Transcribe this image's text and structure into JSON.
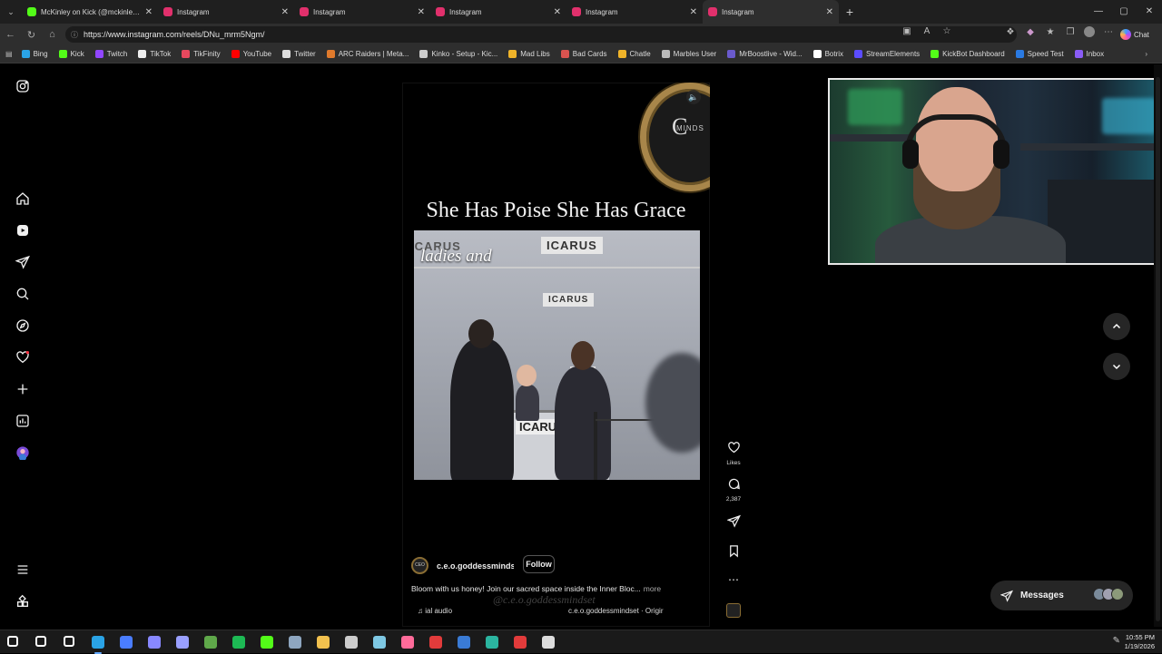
{
  "browser": {
    "tabs": [
      {
        "title": "McKinley on Kick (@mckinley.tv) |",
        "favicon": "kick-green-icon",
        "color": "#53fc18"
      },
      {
        "title": "Instagram",
        "favicon": "instagram-icon",
        "color": "#e1306c"
      },
      {
        "title": "Instagram",
        "favicon": "instagram-icon",
        "color": "#e1306c"
      },
      {
        "title": "Instagram",
        "favicon": "instagram-icon",
        "color": "#e1306c"
      },
      {
        "title": "Instagram",
        "favicon": "instagram-icon",
        "color": "#e1306c"
      },
      {
        "title": "Instagram",
        "favicon": "instagram-icon",
        "color": "#e1306c"
      }
    ],
    "url": "https://www.instagram.com/reels/DNu_mrm5Ngm/",
    "chat_label": "Chat",
    "bookmarks": [
      {
        "label": "Bing",
        "color": "#2aa3e5"
      },
      {
        "label": "Kick",
        "color": "#53fc18"
      },
      {
        "label": "Twitch",
        "color": "#9146ff"
      },
      {
        "label": "TikTok",
        "color": "#eeeeee"
      },
      {
        "label": "TikFinity",
        "color": "#e8485e"
      },
      {
        "label": "YouTube",
        "color": "#ff0000"
      },
      {
        "label": "Twitter",
        "color": "#dddddd"
      },
      {
        "label": "ARC Raiders | Meta...",
        "color": "#e07a2c"
      },
      {
        "label": "Kinko - Setup - Kic...",
        "color": "#cccccc"
      },
      {
        "label": "Mad Libs",
        "color": "#f0b429"
      },
      {
        "label": "Bad Cards",
        "color": "#d9534f"
      },
      {
        "label": "Chatle",
        "color": "#f0b429"
      },
      {
        "label": "Marbles User",
        "color": "#bbbbbb"
      },
      {
        "label": "MrBoostlive - Wid...",
        "color": "#6a5acd"
      },
      {
        "label": "Botrix",
        "color": "#ffffff"
      },
      {
        "label": "StreamElements",
        "color": "#5b4cff"
      },
      {
        "label": "KickBot Dashboard",
        "color": "#53fc18"
      },
      {
        "label": "Speed Test",
        "color": "#2a7ae2"
      },
      {
        "label": "Inbox",
        "color": "#8a5cf6"
      }
    ]
  },
  "reel": {
    "title": "She Has Poise She Has Grace",
    "video_caption": "ladies and",
    "video_signs": [
      "ICARUS",
      "ICARUS",
      "ICARUS",
      "ICARUS"
    ],
    "logo_letters": "C",
    "logo_sub": "MINDS",
    "username": "c.e.o.goddessmindse",
    "follow_label": "Follow",
    "description": "Bloom with us honey! Join our sacred space inside the Inner Bloc...",
    "more_label": "more",
    "watermark": "@c.e.o.goddessmindset",
    "audio_label": "ial audio",
    "audio_source": "c.e.o.goddessmindset · Origir",
    "avatar_text": "CEO"
  },
  "actions": {
    "likes_label": "Likes",
    "comments_count": "2,387"
  },
  "messages_label": "Messages",
  "taskbar": {
    "time": "10:55 PM",
    "date": "1/19/2026",
    "icons": [
      {
        "name": "start-icon",
        "color": "#ffffff"
      },
      {
        "name": "search-icon",
        "color": "#ffffff"
      },
      {
        "name": "task-view-icon",
        "color": "#ffffff"
      },
      {
        "name": "edge-icon",
        "color": "#2aa3e5"
      },
      {
        "name": "chrome-icon",
        "color": "#4a7dff"
      },
      {
        "name": "app-icon",
        "color": "#8888ff"
      },
      {
        "name": "discord-icon",
        "color": "#9aa0ff"
      },
      {
        "name": "minecraft-icon",
        "color": "#5fa84a"
      },
      {
        "name": "spotify-icon",
        "color": "#1db954"
      },
      {
        "name": "kick-icon",
        "color": "#53fc18"
      },
      {
        "name": "steam-icon",
        "color": "#8ea6c0"
      },
      {
        "name": "files-icon",
        "color": "#f2c14e"
      },
      {
        "name": "obs-icon",
        "color": "#cccccc"
      },
      {
        "name": "notepad-icon",
        "color": "#7ec8e3"
      },
      {
        "name": "photos-icon",
        "color": "#ff6b9a"
      },
      {
        "name": "record-icon",
        "color": "#e23b3b"
      },
      {
        "name": "vpn-icon",
        "color": "#3a7bd5"
      },
      {
        "name": "terminal-icon",
        "color": "#2bb5a0"
      },
      {
        "name": "recorder-icon",
        "color": "#e23b3b"
      },
      {
        "name": "settings-icon",
        "color": "#dddddd"
      }
    ]
  }
}
